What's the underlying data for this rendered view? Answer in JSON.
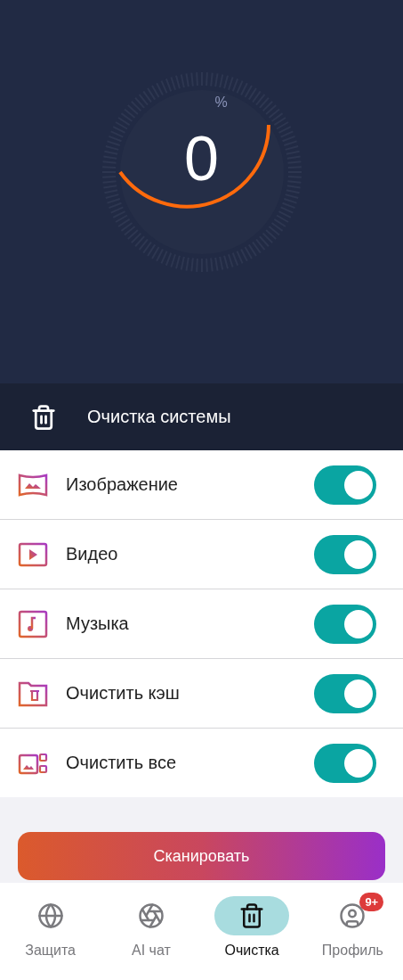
{
  "gauge": {
    "value": "0",
    "unit": "%"
  },
  "header": {
    "title": "Очистка системы"
  },
  "options": [
    {
      "kind": "image",
      "label": "Изображение",
      "on": true
    },
    {
      "kind": "video",
      "label": "Видео",
      "on": true
    },
    {
      "kind": "music",
      "label": "Музыка",
      "on": true
    },
    {
      "kind": "cache",
      "label": "Очистить кэш",
      "on": true
    },
    {
      "kind": "all",
      "label": "Очистить все",
      "on": true
    }
  ],
  "scan_button": "Сканировать",
  "nav": [
    {
      "kind": "shield",
      "label": "Защита",
      "selected": false
    },
    {
      "kind": "ai",
      "label": "AI чат",
      "selected": false
    },
    {
      "kind": "clean",
      "label": "Очистка",
      "selected": true
    },
    {
      "kind": "profile",
      "label": "Профиль",
      "selected": false,
      "badge": "9+"
    }
  ]
}
